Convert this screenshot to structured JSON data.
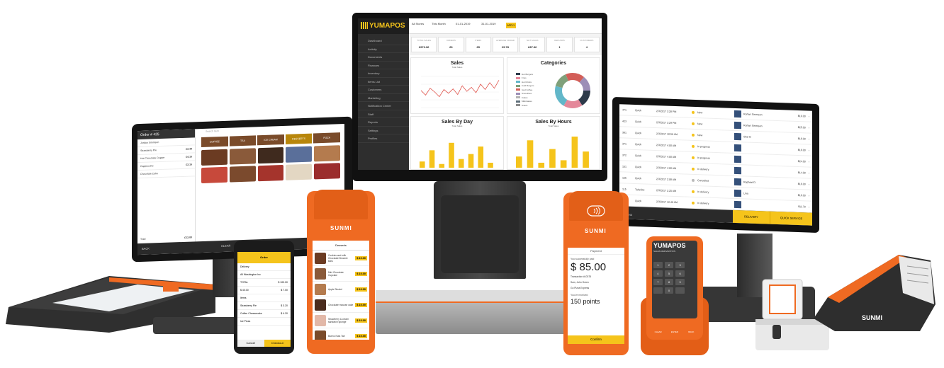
{
  "center_dashboard": {
    "logo": "YUMAPOS",
    "menu": [
      "Dashboard",
      "Activity",
      "Documents",
      "Finances",
      "Inventory",
      "Items List",
      "Customers",
      "Marketing",
      "Notification Center",
      "Staff",
      "Reports",
      "Settings",
      "Profiles"
    ],
    "filters": {
      "stores": "All Stores",
      "period": "This Month",
      "date_from": "01-01-2019",
      "date_to": "31-01-2019",
      "apply_label": "APPLY"
    },
    "kpis": [
      {
        "label": "TOTAL SALES",
        "value": "£973.36"
      },
      {
        "label": "ORDERS",
        "value": "60"
      },
      {
        "label": "ITEMS",
        "value": "65"
      },
      {
        "label": "AVERAGE ORDER",
        "value": "£5.78"
      },
      {
        "label": "NET SALES",
        "value": "£87.36"
      },
      {
        "label": "REFUNDS",
        "value": "1"
      },
      {
        "label": "CUSTOMERS",
        "value": "4"
      }
    ],
    "sales_title": "Sales",
    "sales_legend": "Total Sales",
    "categories_title": "Categories",
    "categories_legend": [
      "Hot Burgers",
      "Fries",
      "Hot Drinks",
      "Cold Burgers",
      "Iced Coffee",
      "Smoothies",
      "Cakes",
      "Milkshakes",
      "Snack"
    ],
    "by_day_title": "Sales By Day",
    "by_day_legend": "Total Sales",
    "by_hours_title": "Sales By Hours",
    "by_hours_legend": "Total Sales",
    "sales_series": [
      55,
      40,
      62,
      50,
      35,
      58,
      46,
      60,
      42,
      70,
      52,
      65,
      48,
      75,
      58,
      80,
      62,
      88
    ],
    "day_bars": [
      10,
      28,
      6,
      40,
      14,
      22,
      34,
      8
    ],
    "hour_bars": [
      18,
      44,
      8,
      30,
      12,
      50,
      26
    ]
  },
  "left_tablet": {
    "order_title": "Order # 425",
    "customer": "Jordan Simmson",
    "lines": [
      {
        "name": "Strawberry Pie",
        "price": "£3.44"
      },
      {
        "name": "Hot Chocolate Frappe",
        "price": "£4.15"
      },
      {
        "name": "Cappuccino",
        "price": "£3.15"
      },
      {
        "name": "Chocolate Cake",
        "price": ""
      }
    ],
    "total_label": "Total",
    "total_value": "£13.00",
    "categories": [
      "COFFEE",
      "TEA",
      "ICE CREAM",
      "DESSERTS",
      "PIZZA"
    ],
    "search_placeholder": "Search Item",
    "footer_labels": [
      "BACK",
      "",
      "",
      "CLEAR",
      ""
    ]
  },
  "phone": {
    "header": "Order",
    "rows": [
      {
        "k": "Delivery",
        "v": ""
      },
      {
        "k": "All Washington Inc",
        "v": ""
      },
      {
        "k": "TOTAL",
        "v": "$ 100.00"
      },
      {
        "k": "$ 40.00",
        "v": "$ 7.00"
      },
      {
        "k": "Items",
        "v": ""
      },
      {
        "k": "Strawberry Pie",
        "v": "$ 3.20"
      },
      {
        "k": "Coffee Cheesecake",
        "v": "$ 4.20"
      },
      {
        "k": "Ice Pizza",
        "v": ""
      }
    ],
    "cancel_label": "Cancel",
    "checkout_label": "Checkout"
  },
  "handheld_menu": {
    "brand": "SUNMI",
    "title": "Desserts",
    "items": [
      {
        "name": "Cookies and milk Chocolate Brownie Bars",
        "price": "$ 10.00"
      },
      {
        "name": "Mini Chocolate Cupcake",
        "price": "$ 10.00"
      },
      {
        "name": "Apple Strudel",
        "price": "$ 10.00"
      },
      {
        "name": "Chocolate mousse cake",
        "price": "$ 10.00"
      },
      {
        "name": "Strawberry & cream sandwich sponge",
        "price": "$ 10.00"
      },
      {
        "name": "Bueno Nuts Tart",
        "price": "$ 10.00"
      }
    ]
  },
  "handheld_payment": {
    "brand": "SUNMI",
    "title": "Payment",
    "paid_msg": "You successfully paid",
    "amount": "$ 85.00",
    "lines": [
      "Transaction #10378",
      "Sam, John Green",
      "Go Pizza Express"
    ],
    "received_label": "You've received",
    "points": "150 points",
    "confirm_label": "Confirm"
  },
  "right_tablet": {
    "rows": [
      {
        "id": "471",
        "type": "Quick",
        "time": "2/3/2017 3:28 PM",
        "status": "New",
        "price": "$19.00"
      },
      {
        "id": "423",
        "type": "Quick",
        "time": "2/3/2017 3:29 PM",
        "status": "New",
        "price": "$25.00"
      },
      {
        "id": "381",
        "type": "Quick",
        "time": "2/3/2017 10:50 AM",
        "status": "New",
        "price": "$18.00"
      },
      {
        "id": "371",
        "type": "Quick",
        "time": "2/3/2017 4:00 AM",
        "status": "In progress",
        "price": "$16.00"
      },
      {
        "id": "372",
        "type": "Quick",
        "time": "2/3/2017 4:00 AM",
        "status": "In progress",
        "price": "$24.00"
      },
      {
        "id": "151",
        "type": "Quick",
        "time": "2/3/2017 4:00 AM",
        "status": "In delivery",
        "price": "$14.00"
      },
      {
        "id": "125",
        "type": "Quick",
        "time": "2/3/2017 2:08 AM",
        "status": "Cancelled",
        "price": "$16.00"
      },
      {
        "id": "115",
        "type": "TakeOut",
        "time": "2/3/2017 2:25 AM",
        "status": "In delivery",
        "price": "$16.00"
      },
      {
        "id": "110",
        "type": "Quick",
        "time": "2/3/2017 12:40 AM",
        "status": "In delivery",
        "price": "$11.70"
      }
    ],
    "names": [
      "Rohan Simmson",
      "Rohan Simmson",
      "Shel B",
      "",
      "",
      "",
      "Raphael D.",
      "Lina",
      ""
    ],
    "menu_label": "MENU",
    "delivery_label": "DELIVERY",
    "quick_label": "QUICK SERVICE"
  },
  "keypad_device": {
    "logo": "YUMAPOS",
    "tagline": "SALES REINVENTION",
    "keys": [
      "1",
      "2",
      "3",
      "4",
      "5",
      "6",
      "7",
      "8",
      "9",
      "",
      "0",
      ""
    ],
    "bottom_keys": [
      "CLEAR",
      "ENTER",
      "BACK"
    ]
  },
  "scanner": {
    "brand": "SUNMI"
  },
  "colors": {
    "accent": "#f5c41b",
    "device_orange": "#ef6a22",
    "bezel": "#1b1b1b"
  }
}
